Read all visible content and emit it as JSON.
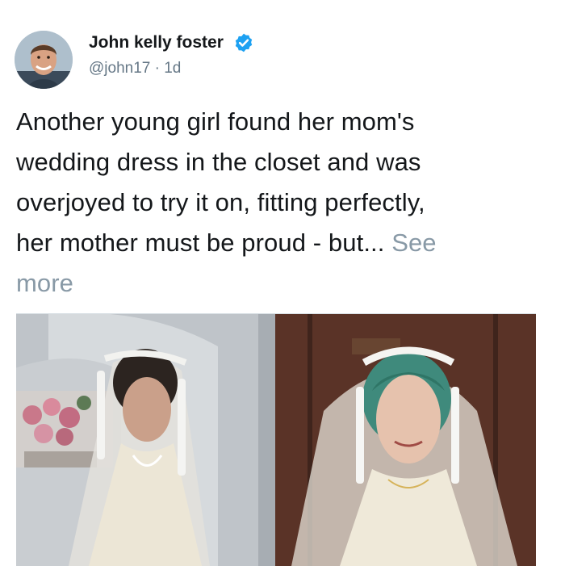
{
  "tweet": {
    "author": {
      "display_name": "John kelly foster",
      "verified": true,
      "handle": "@john17",
      "separator": "·",
      "time": "1d"
    },
    "text_lines": [
      "Another young girl found her mom's",
      "wedding dress in the closet and was",
      "overjoyed to try it on, fitting perfectly,",
      "her mother must be proud - but..."
    ],
    "see_more_label": "See",
    "see_more_label_2": "more"
  },
  "colors": {
    "verified_badge": "#1da1f2",
    "muted_text": "#657786",
    "see_more": "#8899a6"
  },
  "icons": {
    "verified": "verified-check-badge"
  }
}
